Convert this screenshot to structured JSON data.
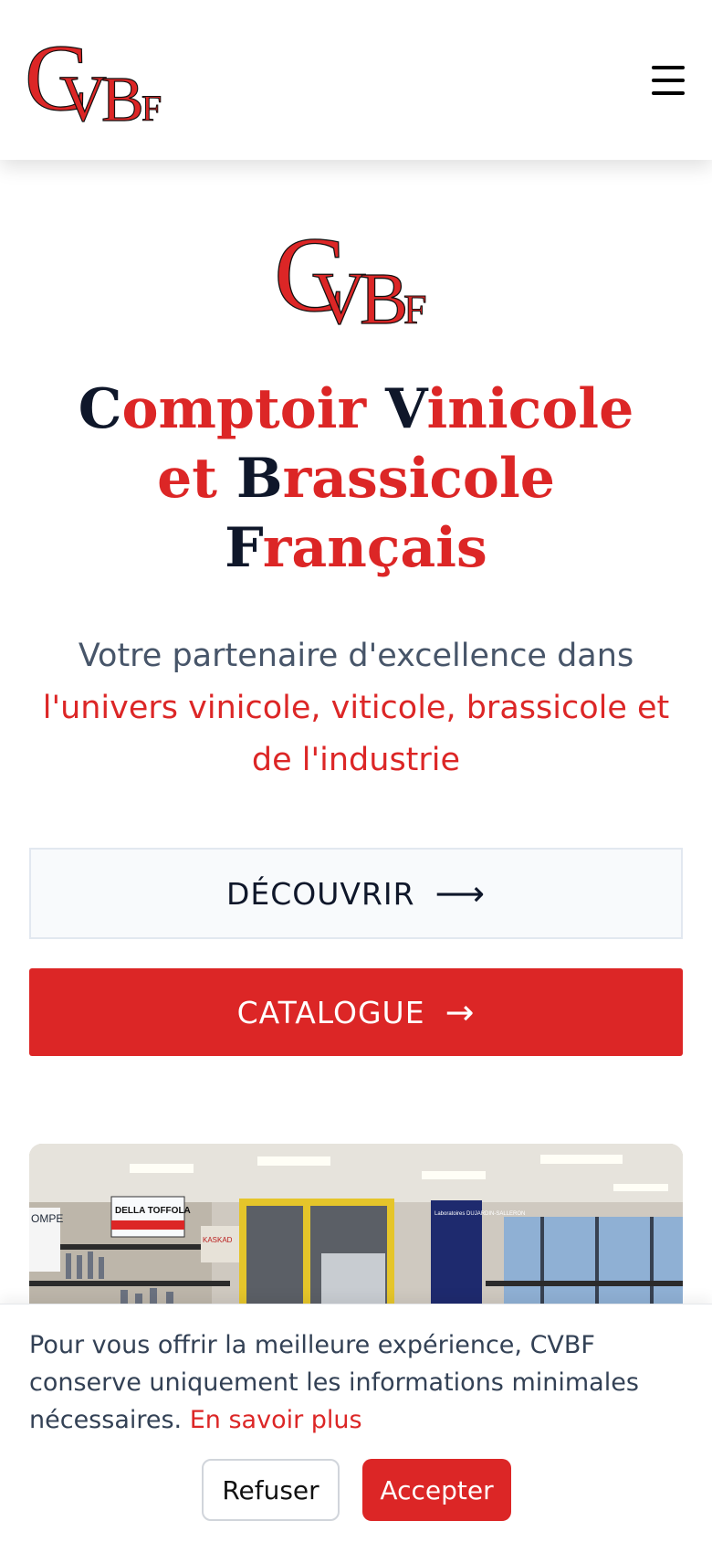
{
  "brand": {
    "logo_letters": "CVBF",
    "colors": {
      "primary_red": "#dc2626",
      "navy": "#0f172a",
      "muted": "#475569"
    }
  },
  "header": {
    "menu_icon": "hamburger-icon"
  },
  "hero": {
    "title": {
      "w1_initial": "C",
      "w1_rest": "omptoir",
      "w2_initial": "V",
      "w2_rest": "inicole",
      "w3": "et",
      "w4_initial": "B",
      "w4_rest": "rassicole",
      "w5_initial": "F",
      "w5_rest": "rançais"
    },
    "tagline_line1": "Votre partenaire d'excellence dans",
    "tagline_accent": "l'univers vinicole, viticole, brassicole et de l'industrie"
  },
  "buttons": {
    "discover": "DÉCOUVRIR",
    "discover_icon": "arrow-right-icon",
    "catalog": "CATALOGUE",
    "catalog_icon": "arrow-right-icon"
  },
  "photo": {
    "signs": [
      "DELLA TOFFOLA",
      "OMPE",
      "KASKAD",
      "Laboratoires DUJARDIN-SALLERON"
    ]
  },
  "cookie": {
    "text": "Pour vous offrir la meilleure expérience, CVBF conserve uniquement les informations minimales nécessaires.",
    "link": "En savoir plus",
    "refuse": "Refuser",
    "accept": "Accepter"
  }
}
